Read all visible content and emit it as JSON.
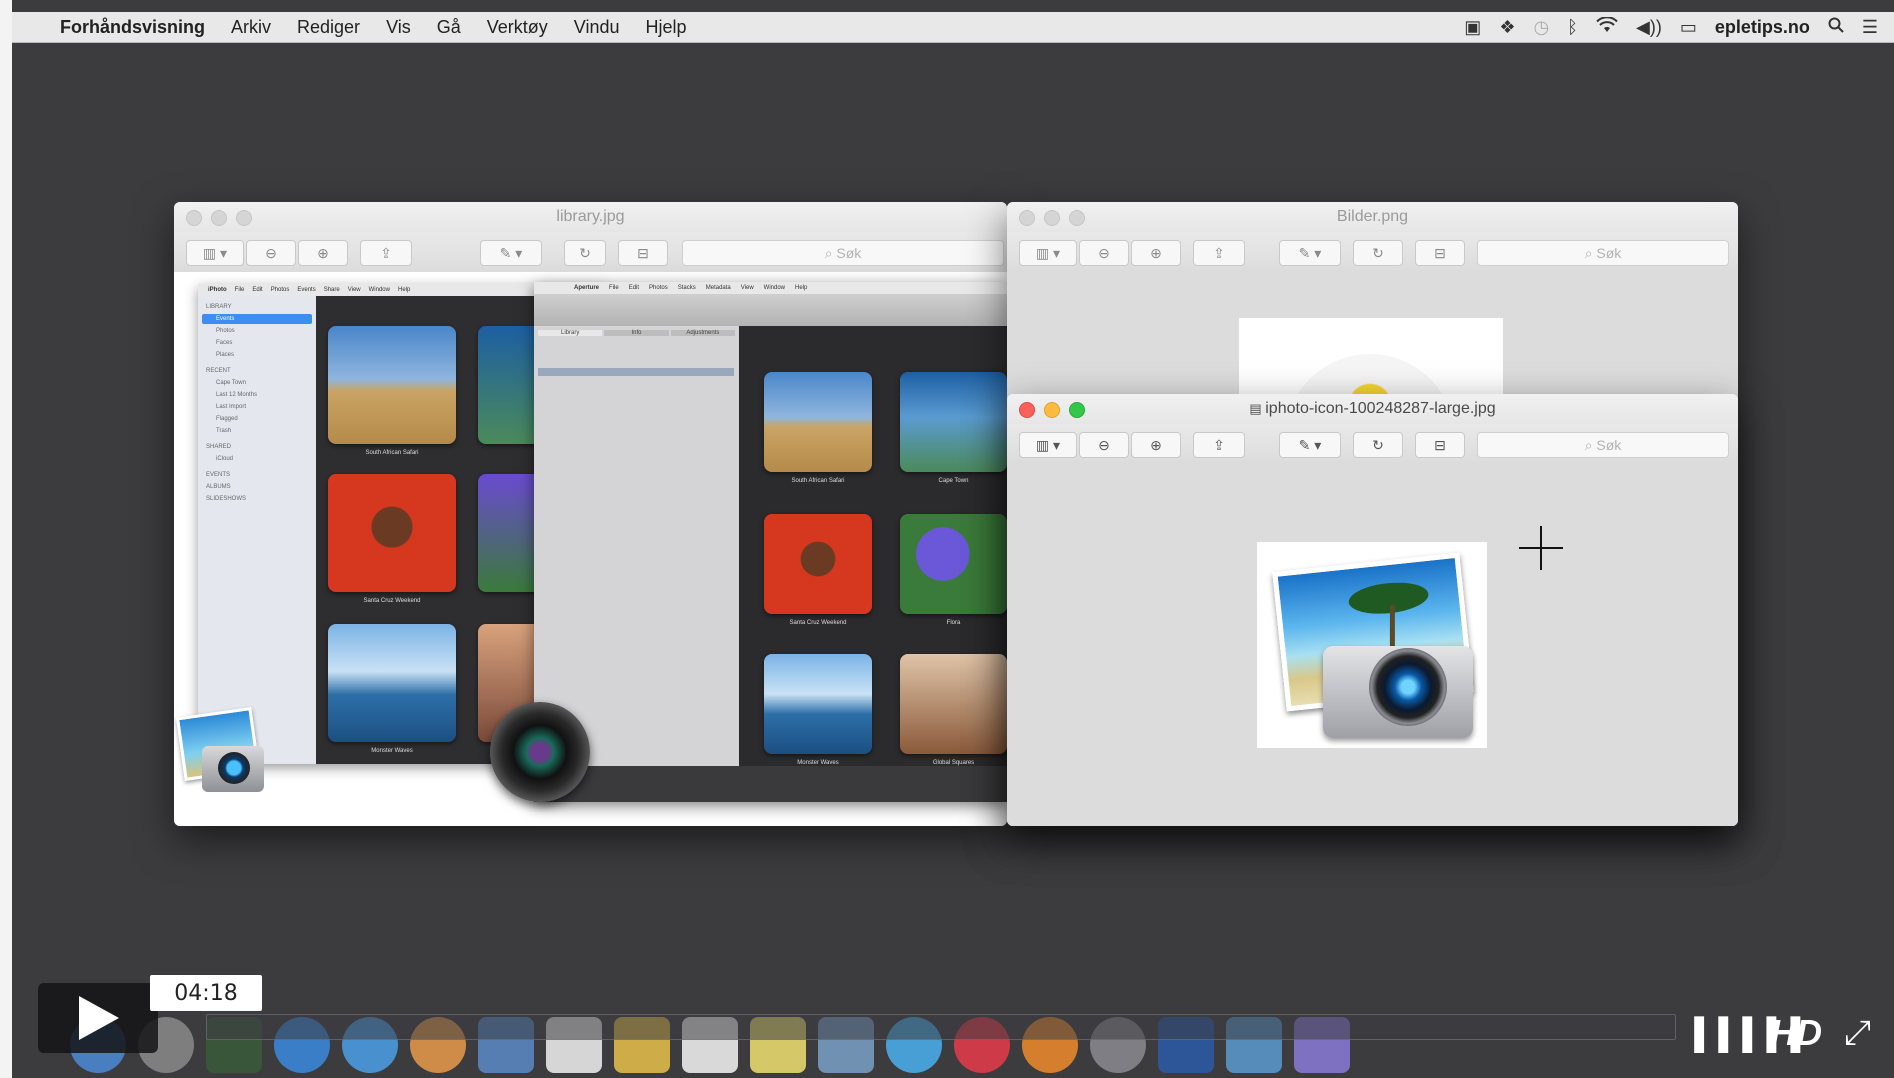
{
  "menubar": {
    "app_name": "Forhåndsvisning",
    "items": [
      "Arkiv",
      "Rediger",
      "Vis",
      "Gå",
      "Verktøy",
      "Vindu",
      "Hjelp"
    ],
    "right_label": "epletips.no"
  },
  "windows": {
    "library": {
      "title": "library.jpg",
      "search_placeholder": "Søk"
    },
    "bilder": {
      "title": "Bilder.png",
      "search_placeholder": "Søk"
    },
    "iphoto": {
      "title": "iphoto-icon-100248287-large.jpg",
      "search_placeholder": "Søk"
    }
  },
  "library_image": {
    "iphoto_menu": [
      "iPhoto",
      "File",
      "Edit",
      "Photos",
      "Events",
      "Share",
      "View",
      "Window",
      "Help"
    ],
    "aperture_menu": [
      "Aperture",
      "File",
      "Edit",
      "Photos",
      "Stacks",
      "Metadata",
      "View",
      "Window",
      "Help"
    ],
    "captions": [
      "South African Safari",
      "Santa Cruz Weekend",
      "Monster Waves",
      "Cape Town",
      "Flora",
      "Global Squares"
    ],
    "sidebar": [
      "LIBRARY",
      "Events",
      "Photos",
      "Faces",
      "Places",
      "RECENT",
      "Cape Town",
      "Last 12 Months",
      "Last Import",
      "Flagged",
      "Trash",
      "SHARED",
      "iCloud",
      "EVENTS",
      "ALBUMS",
      "SLIDESHOWS"
    ],
    "aperture_tabs": [
      "Library",
      "Info",
      "Adjustments"
    ]
  },
  "player": {
    "time": "04:18",
    "hd_label": "HD"
  },
  "colors": {
    "desktop": "#3c3c3e",
    "red_light": "#fc605c",
    "yellow_light": "#fdbc40",
    "green_light": "#34c84a"
  }
}
